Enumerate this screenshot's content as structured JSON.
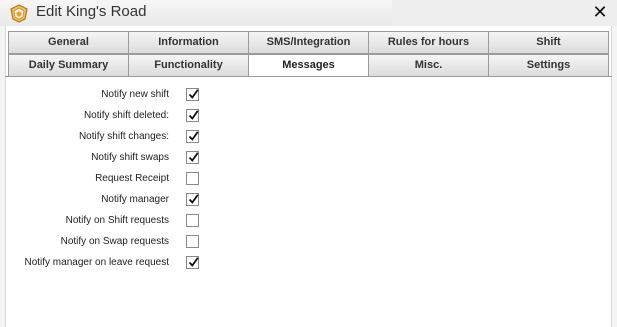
{
  "window": {
    "title": "Edit King's Road",
    "logo_icon": "crown-shield-icon",
    "close_icon": "close-icon"
  },
  "tabs": {
    "row1": [
      "General",
      "Information",
      "SMS/Integration",
      "Rules for hours",
      "Shift"
    ],
    "row2": [
      "Daily Summary",
      "Functionality",
      "Messages",
      "Misc.",
      "Settings"
    ],
    "active": "Messages"
  },
  "options": [
    {
      "label": "Notify new shift",
      "checked": true
    },
    {
      "label": "Notify shift deleted:",
      "checked": true
    },
    {
      "label": "Notify shift changes:",
      "checked": true
    },
    {
      "label": "Notify shift swaps",
      "checked": true
    },
    {
      "label": "Request Receipt",
      "checked": false
    },
    {
      "label": "Notify manager",
      "checked": true
    },
    {
      "label": "Notify on Shift requests",
      "checked": false
    },
    {
      "label": "Notify on Swap requests",
      "checked": false
    },
    {
      "label": "Notify manager on leave request",
      "checked": true
    }
  ],
  "colors": {
    "accent": "#e8a23a",
    "tab_border": "#9a9a9a"
  }
}
